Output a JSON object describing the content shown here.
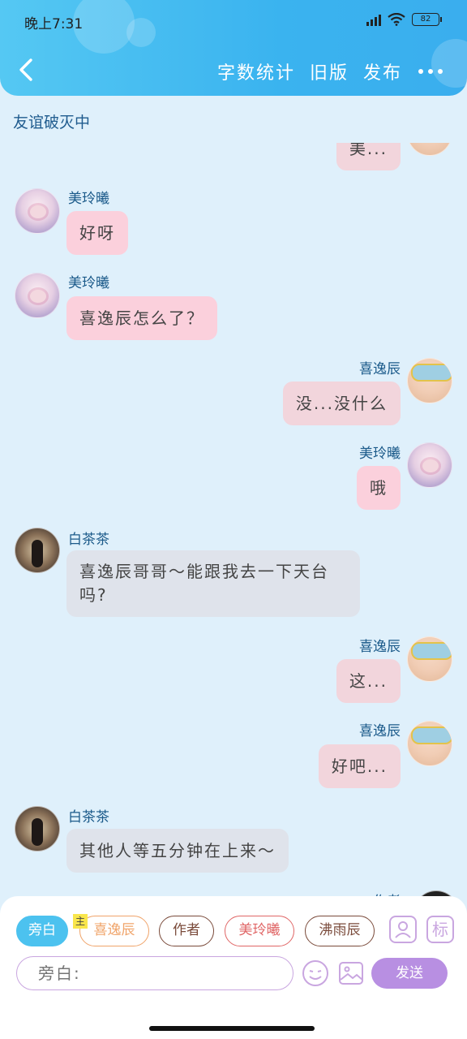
{
  "status_bar": {
    "time": "晚上7:31",
    "battery": "82",
    "icons": [
      "hd-icon",
      "signal-icon",
      "wifi-icon",
      "battery-icon"
    ]
  },
  "header": {
    "actions": [
      "字数统计",
      "旧版",
      "发布"
    ],
    "accent": "#3ab3ef"
  },
  "section": {
    "title": "友谊破灭中"
  },
  "messages": [
    {
      "side": "right",
      "name": "",
      "avatar": "xi",
      "text": "美...",
      "bubble": "rose"
    },
    {
      "side": "left",
      "name": "美玲曦",
      "avatar": "mei",
      "text": "好呀",
      "bubble": "pink"
    },
    {
      "side": "left",
      "name": "美玲曦",
      "avatar": "mei",
      "text": "喜逸辰怎么了？",
      "bubble": "pink"
    },
    {
      "side": "right",
      "name": "喜逸辰",
      "avatar": "xi",
      "text": "没...没什么",
      "bubble": "rose"
    },
    {
      "side": "right",
      "name": "美玲曦",
      "avatar": "mei",
      "text": "哦",
      "bubble": "pink"
    },
    {
      "side": "left",
      "name": "白茶茶",
      "avatar": "bai",
      "text": "喜逸辰哥哥～能跟我去一下天台吗?",
      "bubble": "gray"
    },
    {
      "side": "right",
      "name": "喜逸辰",
      "avatar": "xi",
      "text": "这...",
      "bubble": "rose"
    },
    {
      "side": "right",
      "name": "喜逸辰",
      "avatar": "xi",
      "text": "好吧...",
      "bubble": "rose"
    },
    {
      "side": "left",
      "name": "白茶茶",
      "avatar": "bai",
      "text": "其他人等五分钟在上来～",
      "bubble": "gray"
    },
    {
      "side": "right",
      "name": "作者",
      "avatar": "author",
      "text": "",
      "bubble": "gray"
    }
  ],
  "roles": [
    {
      "label": "旁白",
      "active": true,
      "color": "#4cc2ef"
    },
    {
      "label": "喜逸辰",
      "active": false,
      "color": "#f0a46a",
      "badge": "主"
    },
    {
      "label": "作者",
      "active": false,
      "color": "#7a4a3a"
    },
    {
      "label": "美玲曦",
      "active": false,
      "color": "#e06666"
    },
    {
      "label": "沸雨辰",
      "active": false,
      "color": "#7a4a3a"
    }
  ],
  "role_tools": {
    "tag_label": "标"
  },
  "composer": {
    "placeholder": "旁白:",
    "send_label": "发送",
    "accent": "#b88fe2"
  }
}
